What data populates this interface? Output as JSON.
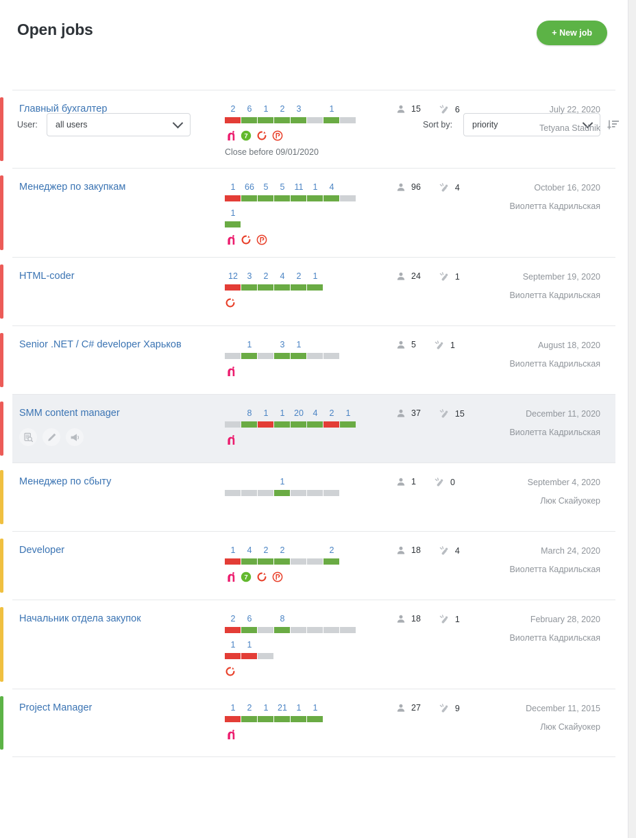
{
  "header": {
    "title": "Open jobs",
    "new_job_label": "+ New job"
  },
  "filters": {
    "user_label": "User:",
    "user_value": "all users",
    "sort_label": "Sort by:",
    "sort_value": "priority",
    "sort_direction_icon": "sort-descending-icon"
  },
  "colors": {
    "accent_green": "#5cb346",
    "bar_green": "#6aab44",
    "bar_red": "#e33d36",
    "bar_gray": "#cfd2d5",
    "priority_high": "#ec5b57",
    "priority_medium": "#f0c040",
    "priority_low": "#5cb346",
    "link_blue": "#3b74b3",
    "stage_num_blue": "#4b84c4",
    "muted_gray": "#90959b"
  },
  "icon_legend": {
    "candidates": "person-icon",
    "interviews": "microphone-icon",
    "flag_pink": "pink-knight-icon",
    "flag_green7": "green-circle-7-icon",
    "flag_red_arc": "red-arc-icon",
    "flag_red_r": "red-circle-r-icon",
    "action_preview": "document-search-icon",
    "action_edit": "pencil-icon",
    "action_promote": "megaphone-icon"
  },
  "jobs": [
    {
      "title": "Главный бухгалтер",
      "priority": "high",
      "stage_groups": [
        {
          "numbers": [
            "2",
            "6",
            "1",
            "2",
            "3",
            "",
            "1",
            ""
          ],
          "segments": [
            "red",
            "green",
            "green",
            "green",
            "green",
            "gray",
            "green",
            "gray"
          ]
        }
      ],
      "flags": [
        "pink-knight-icon",
        "green-circle-7-icon",
        "red-arc-icon",
        "red-circle-r-icon"
      ],
      "close_before": "Close before 09/01/2020",
      "candidates": "15",
      "interviews": "6",
      "date": "July 22, 2020",
      "owner": "Tetyana Stadnik",
      "selected": false,
      "actions": []
    },
    {
      "title": "Менеджер по закупкам",
      "priority": "high",
      "stage_groups": [
        {
          "numbers": [
            "1",
            "66",
            "5",
            "5",
            "11",
            "1",
            "4",
            ""
          ],
          "segments": [
            "red",
            "green",
            "green",
            "green",
            "green",
            "green",
            "green",
            "gray"
          ]
        },
        {
          "numbers": [
            "1"
          ],
          "segments": [
            "green"
          ]
        }
      ],
      "flags": [
        "pink-knight-icon",
        "red-arc-icon",
        "red-circle-r-icon"
      ],
      "close_before": "",
      "candidates": "96",
      "interviews": "4",
      "date": "October 16, 2020",
      "owner": "Виолетта Кадрильская",
      "selected": false,
      "actions": []
    },
    {
      "title": "HTML-coder",
      "priority": "high",
      "stage_groups": [
        {
          "numbers": [
            "12",
            "3",
            "2",
            "4",
            "2",
            "1"
          ],
          "segments": [
            "red",
            "green",
            "green",
            "green",
            "green",
            "green"
          ]
        }
      ],
      "flags": [
        "red-arc-icon"
      ],
      "close_before": "",
      "candidates": "24",
      "interviews": "1",
      "date": "September 19, 2020",
      "owner": "Виолетта Кадрильская",
      "selected": false,
      "actions": []
    },
    {
      "title": "Senior .NET / C# developer Харьков",
      "priority": "high",
      "stage_groups": [
        {
          "numbers": [
            "",
            "1",
            "",
            "3",
            "1",
            "",
            ""
          ],
          "segments": [
            "gray",
            "green",
            "gray",
            "green",
            "green",
            "gray",
            "gray"
          ]
        }
      ],
      "flags": [
        "pink-knight-icon"
      ],
      "close_before": "",
      "candidates": "5",
      "interviews": "1",
      "date": "August 18, 2020",
      "owner": "Виолетта Кадрильская",
      "selected": false,
      "actions": []
    },
    {
      "title": "SMM content manager",
      "priority": "high",
      "stage_groups": [
        {
          "numbers": [
            "",
            "8",
            "1",
            "1",
            "20",
            "4",
            "2",
            "1"
          ],
          "segments": [
            "gray",
            "green",
            "red",
            "green",
            "green",
            "green",
            "red",
            "green"
          ]
        }
      ],
      "flags": [
        "pink-knight-icon"
      ],
      "close_before": "",
      "candidates": "37",
      "interviews": "15",
      "date": "December 11, 2020",
      "owner": "Виолетта Кадрильская",
      "selected": true,
      "actions": [
        "document-search-icon",
        "pencil-icon",
        "megaphone-icon"
      ]
    },
    {
      "title": "Менеджер по сбыту",
      "priority": "medium",
      "stage_groups": [
        {
          "numbers": [
            "",
            "",
            "",
            "1",
            "",
            "",
            ""
          ],
          "segments": [
            "gray",
            "gray",
            "gray",
            "green",
            "gray",
            "gray",
            "gray"
          ]
        }
      ],
      "flags": [],
      "close_before": "",
      "candidates": "1",
      "interviews": "0",
      "date": "September 4, 2020",
      "owner": "Люк Скайуокер",
      "selected": false,
      "actions": []
    },
    {
      "title": "Developer",
      "priority": "medium",
      "stage_groups": [
        {
          "numbers": [
            "1",
            "4",
            "2",
            "2",
            "",
            "",
            "2"
          ],
          "segments": [
            "red",
            "green",
            "green",
            "green",
            "gray",
            "gray",
            "green"
          ]
        }
      ],
      "flags": [
        "pink-knight-icon",
        "green-circle-7-icon",
        "red-arc-icon",
        "red-circle-r-icon"
      ],
      "close_before": "",
      "candidates": "18",
      "interviews": "4",
      "date": "March 24, 2020",
      "owner": "Виолетта Кадрильская",
      "selected": false,
      "actions": []
    },
    {
      "title": "Начальник отдела закупок",
      "priority": "medium",
      "stage_groups": [
        {
          "numbers": [
            "2",
            "6",
            "",
            "8",
            "",
            "",
            "",
            ""
          ],
          "segments": [
            "red",
            "green",
            "gray",
            "green",
            "gray",
            "gray",
            "gray",
            "gray"
          ]
        },
        {
          "numbers": [
            "1",
            "1",
            ""
          ],
          "segments": [
            "red",
            "red",
            "gray"
          ]
        }
      ],
      "flags": [
        "red-arc-icon"
      ],
      "close_before": "",
      "candidates": "18",
      "interviews": "1",
      "date": "February 28, 2020",
      "owner": "Виолетта Кадрильская",
      "selected": false,
      "actions": []
    },
    {
      "title": "Project Manager",
      "priority": "low",
      "stage_groups": [
        {
          "numbers": [
            "1",
            "2",
            "1",
            "21",
            "1",
            "1"
          ],
          "segments": [
            "red",
            "green",
            "green",
            "green",
            "green",
            "green"
          ]
        }
      ],
      "flags": [
        "pink-knight-icon"
      ],
      "close_before": "",
      "candidates": "27",
      "interviews": "9",
      "date": "December 11, 2015",
      "owner": "Люк Скайуокер",
      "selected": false,
      "actions": []
    }
  ]
}
